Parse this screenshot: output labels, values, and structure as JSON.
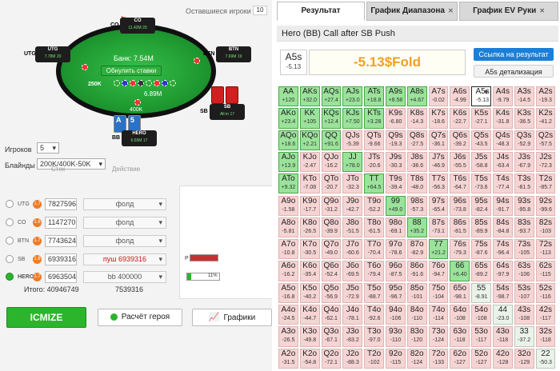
{
  "left": {
    "players_left_label": "Оставшиеся игроки",
    "players_left_value": "10",
    "seats": {
      "co": {
        "name": "CO",
        "stack": "11.42M",
        "bb": "29"
      },
      "utg": {
        "name": "UTG",
        "stack": "7.78M",
        "bb": "20"
      },
      "btn": {
        "name": "BTN",
        "stack": "7.69M",
        "bb": "19"
      },
      "sb": {
        "name": "SB",
        "stack": "All-in",
        "bb": "17"
      },
      "hero": {
        "name": "HERO",
        "stack": "6.59M",
        "bb": "17"
      }
    },
    "bank_label": "Банк: 7.54M",
    "reset_bets": "Обнулить ставки",
    "pot_bet": "6.89M",
    "hero_bet": "400K",
    "amt_left": "6.89M",
    "chip_label": "250K",
    "hero_cards": [
      "A",
      "5"
    ],
    "players_label": "Игроков",
    "players_value": "5",
    "blinds_label": "Блайнды",
    "blinds_value": "200K/400K-50K",
    "stack_col": "Стек",
    "action_col": "Действие",
    "rows": [
      {
        "pos": "UTG",
        "badge": "1.7",
        "stack": "7827596",
        "action": "фолд"
      },
      {
        "pos": "CO",
        "badge": "1.6",
        "stack": "1147270",
        "action": "фолд"
      },
      {
        "pos": "BTN",
        "badge": "1.7",
        "stack": "7743624",
        "action": "фолд"
      },
      {
        "pos": "SB",
        "badge": "1.8",
        "stack": "6939316",
        "action": "пуш 6939316"
      },
      {
        "pos": "HERO",
        "badge": "1.7",
        "stack": "6963504",
        "action": "bb 400000"
      }
    ],
    "total_label": "Итого: 40946749",
    "total_pot": "7539316",
    "progress_p_label": "P",
    "progress_pct": "11%",
    "btn_icmize": "ICMIZE",
    "btn_calc": "Расчёт героя",
    "btn_graphs": "Графики"
  },
  "right": {
    "tabs": [
      "Результат",
      "График Диапазона",
      "График EV Руки"
    ],
    "title": "Hero (BB) Call after SB Push",
    "sel_hand": "A5s",
    "sel_value": "-5.13",
    "ev_result": "-5.13$Fold",
    "link_result": "Ссылка на результат",
    "link_detail": "A5s детализация",
    "accent": "#1a7fd8",
    "grid": [
      [
        [
          "AA",
          "+120",
          "g"
        ],
        [
          "AKs",
          "+32.0",
          "g"
        ],
        [
          "AQs",
          "+27.4",
          "g"
        ],
        [
          "AJs",
          "+23.0",
          "g"
        ],
        [
          "ATs",
          "+18.8",
          "g"
        ],
        [
          "A9s",
          "+8.58",
          "g"
        ],
        [
          "A8s",
          "+4.67",
          "g"
        ],
        [
          "A7s",
          "-0.02",
          "r"
        ],
        [
          "A6s",
          "-4.99",
          "r"
        ],
        [
          "A5s",
          "-5.13",
          "s"
        ],
        [
          "A4s",
          "-9.79",
          "r"
        ],
        [
          "A3s",
          "-14.5",
          "r"
        ],
        [
          "A2s",
          "-19.3",
          "r"
        ]
      ],
      [
        [
          "AKo",
          "+23.4",
          "g"
        ],
        [
          "KK",
          "+105",
          "g"
        ],
        [
          "KQs",
          "+12.4",
          "g"
        ],
        [
          "KJs",
          "+7.50",
          "g"
        ],
        [
          "KTs",
          "+3.28",
          "g"
        ],
        [
          "K9s",
          "-6.80",
          "r"
        ],
        [
          "K8s",
          "-14.3",
          "r"
        ],
        [
          "K7s",
          "-18.6",
          "r"
        ],
        [
          "K6s",
          "-22.7",
          "r"
        ],
        [
          "K5s",
          "-27.1",
          "r"
        ],
        [
          "K4s",
          "-31.8",
          "r"
        ],
        [
          "K3s",
          "-36.5",
          "r"
        ],
        [
          "K2s",
          "-41.2",
          "r"
        ]
      ],
      [
        [
          "AQo",
          "+18.6",
          "g"
        ],
        [
          "KQo",
          "+2.21",
          "g"
        ],
        [
          "QQ",
          "+91.6",
          "g"
        ],
        [
          "QJs",
          "-5.39",
          "r"
        ],
        [
          "QTs",
          "-9.66",
          "r"
        ],
        [
          "Q9s",
          "-19.3",
          "r"
        ],
        [
          "Q8s",
          "-27.5",
          "r"
        ],
        [
          "Q7s",
          "-36.1",
          "r"
        ],
        [
          "Q6s",
          "-39.2",
          "r"
        ],
        [
          "Q5s",
          "-43.5",
          "r"
        ],
        [
          "Q4s",
          "-48.3",
          "r"
        ],
        [
          "Q3s",
          "-52.9",
          "r"
        ],
        [
          "Q2s",
          "-57.5",
          "r"
        ]
      ],
      [
        [
          "AJo",
          "+13.9",
          "g"
        ],
        [
          "KJo",
          "-2.47",
          "r"
        ],
        [
          "QJo",
          "-16.2",
          "r"
        ],
        [
          "JJ",
          "+78.0",
          "g"
        ],
        [
          "JTs",
          "-20.6",
          "r"
        ],
        [
          "J9s",
          "-30.3",
          "r"
        ],
        [
          "J8s",
          "-38.6",
          "r"
        ],
        [
          "J7s",
          "-46.9",
          "r"
        ],
        [
          "J6s",
          "-55.5",
          "r"
        ],
        [
          "J5s",
          "-58.8",
          "r"
        ],
        [
          "J4s",
          "-63.4",
          "r"
        ],
        [
          "J3s",
          "-67.9",
          "r"
        ],
        [
          "J2s",
          "-72.3",
          "r"
        ]
      ],
      [
        [
          "ATo",
          "+9.32",
          "g"
        ],
        [
          "KTo",
          "-7.08",
          "r"
        ],
        [
          "QTo",
          "-20.7",
          "r"
        ],
        [
          "JTo",
          "-32.3",
          "r"
        ],
        [
          "TT",
          "+64.5",
          "g"
        ],
        [
          "T9s",
          "-39.4",
          "r"
        ],
        [
          "T8s",
          "-48.0",
          "r"
        ],
        [
          "T7s",
          "-56.3",
          "r"
        ],
        [
          "T6s",
          "-64.7",
          "r"
        ],
        [
          "T5s",
          "-73.6",
          "r"
        ],
        [
          "T4s",
          "-77.4",
          "r"
        ],
        [
          "T3s",
          "-81.5",
          "r"
        ],
        [
          "T2s",
          "-85.7",
          "r"
        ]
      ],
      [
        [
          "A9o",
          "-1.58",
          "r"
        ],
        [
          "K9o",
          "-17.7",
          "r"
        ],
        [
          "Q9o",
          "-31.2",
          "r"
        ],
        [
          "J9o",
          "-42.7",
          "r"
        ],
        [
          "T9o",
          "-52.2",
          "r"
        ],
        [
          "99",
          "+49.0",
          "g"
        ],
        [
          "98s",
          "-57.3",
          "r"
        ],
        [
          "97s",
          "-65.4",
          "r"
        ],
        [
          "96s",
          "-73.8",
          "r"
        ],
        [
          "95s",
          "-82.4",
          "r"
        ],
        [
          "94s",
          "-91.7",
          "r"
        ],
        [
          "93s",
          "-95.8",
          "r"
        ],
        [
          "92s",
          "-99.6",
          "r"
        ]
      ],
      [
        [
          "A8o",
          "-5.81",
          "r"
        ],
        [
          "K8o",
          "-26.5",
          "r"
        ],
        [
          "Q8o",
          "-39.9",
          "r"
        ],
        [
          "J8o",
          "-51.5",
          "r"
        ],
        [
          "T8o",
          "-61.5",
          "r"
        ],
        [
          "98o",
          "-69.1",
          "r"
        ],
        [
          "88",
          "+35.2",
          "g"
        ],
        [
          "87s",
          "-73.1",
          "r"
        ],
        [
          "86s",
          "-81.5",
          "r"
        ],
        [
          "85s",
          "-89.9",
          "r"
        ],
        [
          "84s",
          "-84.8",
          "r"
        ],
        [
          "83s",
          "-93.7",
          "r"
        ],
        [
          "82s",
          "-103",
          "r"
        ]
      ],
      [
        [
          "A7o",
          "-10.8",
          "r"
        ],
        [
          "K7o",
          "-30.5",
          "r"
        ],
        [
          "Q7o",
          "-49.0",
          "r"
        ],
        [
          "J7o",
          "-60.6",
          "r"
        ],
        [
          "T7o",
          "-70.4",
          "r"
        ],
        [
          "97o",
          "-78.6",
          "r"
        ],
        [
          "87o",
          "-82.9",
          "r"
        ],
        [
          "77",
          "+21.2",
          "g"
        ],
        [
          "76s",
          "-79.3",
          "r"
        ],
        [
          "75s",
          "-87.6",
          "r"
        ],
        [
          "74s",
          "-96.4",
          "r"
        ],
        [
          "73s",
          "-105",
          "r"
        ],
        [
          "72s",
          "-113",
          "r"
        ]
      ],
      [
        [
          "A6o",
          "-16.2",
          "r"
        ],
        [
          "K6o",
          "-35.4",
          "r"
        ],
        [
          "Q6o",
          "-52.4",
          "r"
        ],
        [
          "J6o",
          "-69.5",
          "r"
        ],
        [
          "T6o",
          "-79.4",
          "r"
        ],
        [
          "96o",
          "-87.5",
          "r"
        ],
        [
          "86o",
          "-91.6",
          "r"
        ],
        [
          "76o",
          "-94.7",
          "r"
        ],
        [
          "66",
          "+6.40",
          "g"
        ],
        [
          "65s",
          "-89.2",
          "r"
        ],
        [
          "64s",
          "-97.9",
          "r"
        ],
        [
          "63s",
          "-106",
          "r"
        ],
        [
          "62s",
          "-115",
          "r"
        ]
      ],
      [
        [
          "A5o",
          "-16.8",
          "r"
        ],
        [
          "K5o",
          "-40.2",
          "r"
        ],
        [
          "Q5o",
          "-56.9",
          "r"
        ],
        [
          "J5o",
          "-72.9",
          "r"
        ],
        [
          "T5o",
          "-88.7",
          "r"
        ],
        [
          "95o",
          "-96.7",
          "r"
        ],
        [
          "85o",
          "-101",
          "r"
        ],
        [
          "75o",
          "-104",
          "r"
        ],
        [
          "65o",
          "-98.1",
          "r"
        ],
        [
          "55",
          "-8.91",
          "p"
        ],
        [
          "54s",
          "-98.7",
          "r"
        ],
        [
          "53s",
          "-107",
          "r"
        ],
        [
          "52s",
          "-116",
          "r"
        ]
      ],
      [
        [
          "A4o",
          "-24.5",
          "r"
        ],
        [
          "K4o",
          "-44.7",
          "r"
        ],
        [
          "Q4o",
          "-62.1",
          "r"
        ],
        [
          "J4o",
          "-78.1",
          "r"
        ],
        [
          "T4o",
          "-92.6",
          "r"
        ],
        [
          "94o",
          "-106",
          "r"
        ],
        [
          "84o",
          "-110",
          "r"
        ],
        [
          "74o",
          "-114",
          "r"
        ],
        [
          "64o",
          "-108",
          "r"
        ],
        [
          "54o",
          "-108",
          "r"
        ],
        [
          "44",
          "-23.0",
          "p"
        ],
        [
          "43s",
          "-108",
          "r"
        ],
        [
          "42s",
          "-117",
          "r"
        ]
      ],
      [
        [
          "A3o",
          "-26.5",
          "r"
        ],
        [
          "K3o",
          "-49.8",
          "r"
        ],
        [
          "Q3o",
          "-67.1",
          "r"
        ],
        [
          "J3o",
          "-83.2",
          "r"
        ],
        [
          "T3o",
          "-97.0",
          "r"
        ],
        [
          "93o",
          "-110",
          "r"
        ],
        [
          "83o",
          "-120",
          "r"
        ],
        [
          "73o",
          "-124",
          "r"
        ],
        [
          "63o",
          "-118",
          "r"
        ],
        [
          "53o",
          "-117",
          "r"
        ],
        [
          "43o",
          "-118",
          "r"
        ],
        [
          "33",
          "-37.2",
          "p"
        ],
        [
          "32s",
          "-118",
          "r"
        ]
      ],
      [
        [
          "A2o",
          "-31.5",
          "r"
        ],
        [
          "K2o",
          "-54.8",
          "r"
        ],
        [
          "Q2o",
          "-72.1",
          "r"
        ],
        [
          "J2o",
          "-88.3",
          "r"
        ],
        [
          "T2o",
          "-102",
          "r"
        ],
        [
          "92o",
          "-115",
          "r"
        ],
        [
          "82o",
          "-124",
          "r"
        ],
        [
          "72o",
          "-133",
          "r"
        ],
        [
          "62o",
          "-127",
          "r"
        ],
        [
          "52o",
          "-127",
          "r"
        ],
        [
          "42o",
          "-128",
          "r"
        ],
        [
          "32o",
          "-129",
          "r"
        ],
        [
          "22",
          "-50.3",
          "p"
        ]
      ]
    ]
  }
}
